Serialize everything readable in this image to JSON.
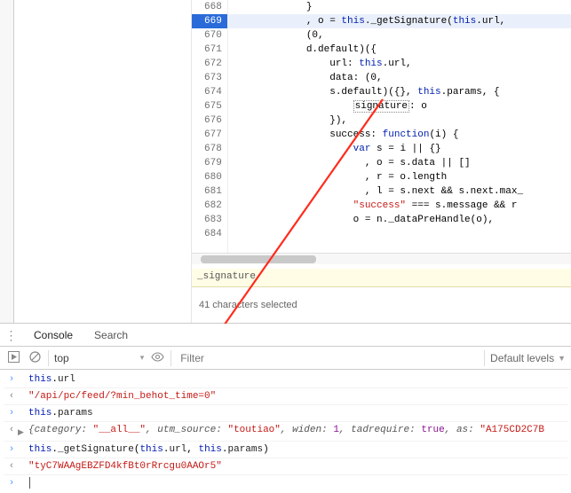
{
  "code": {
    "lines": [
      {
        "n": 668,
        "text": "}",
        "hl": false
      },
      {
        "n": 669,
        "text": ", o = |this|._getSignature(|this|.url, ",
        "hl": true
      },
      {
        "n": 670,
        "text": "(0,",
        "hl": false
      },
      {
        "n": 671,
        "text": "d.default)({",
        "hl": false
      },
      {
        "n": 672,
        "text": "    url: |this|.url,",
        "hl": false
      },
      {
        "n": 673,
        "text": "    data: (0,",
        "hl": false
      },
      {
        "n": 674,
        "text": "    s.default)({}, |this|.params, {",
        "hl": false
      },
      {
        "n": 675,
        "text": "        [signature]: o",
        "hl": false
      },
      {
        "n": 676,
        "text": "    }),",
        "hl": false
      },
      {
        "n": 677,
        "text": "    success: |function|(i) {",
        "hl": false
      },
      {
        "n": 678,
        "text": "        |var| s = i || {}",
        "hl": false
      },
      {
        "n": 679,
        "text": "          , o = s.data || []",
        "hl": false
      },
      {
        "n": 680,
        "text": "          , r = o.length",
        "hl": false
      },
      {
        "n": 681,
        "text": "          , l = s.next && s.next.max_",
        "hl": false
      },
      {
        "n": 682,
        "text": "        |\"success\"| === s.message && r ",
        "hl": false
      },
      {
        "n": 683,
        "text": "        o = n._dataPreHandle(o),",
        "hl": false
      },
      {
        "n": 684,
        "text": "",
        "hl": false
      }
    ],
    "highlight_word": "_signature",
    "status": "41 characters selected"
  },
  "tabs": {
    "console": "Console",
    "search": "Search"
  },
  "toolbar": {
    "context": "top",
    "filter_placeholder": "Filter",
    "levels": "Default levels"
  },
  "console": [
    {
      "kind": "in",
      "text": "this.url"
    },
    {
      "kind": "out",
      "text": "\"/api/pc/feed/?min_behot_time=0\"",
      "cls": "red"
    },
    {
      "kind": "in",
      "text": "this.params"
    },
    {
      "kind": "obj",
      "text": "{category: \"__all__\", utm_source: \"toutiao\", widen: 1, tadrequire: true, as: \"A175CD2C7B"
    },
    {
      "kind": "in",
      "text": "this._getSignature(this.url, this.params)"
    },
    {
      "kind": "out",
      "text": "\"tyC7WAAgEBZFD4kfBt0rRrcgu0AAOr5\"",
      "cls": "red"
    },
    {
      "kind": "prompt",
      "text": ""
    }
  ]
}
